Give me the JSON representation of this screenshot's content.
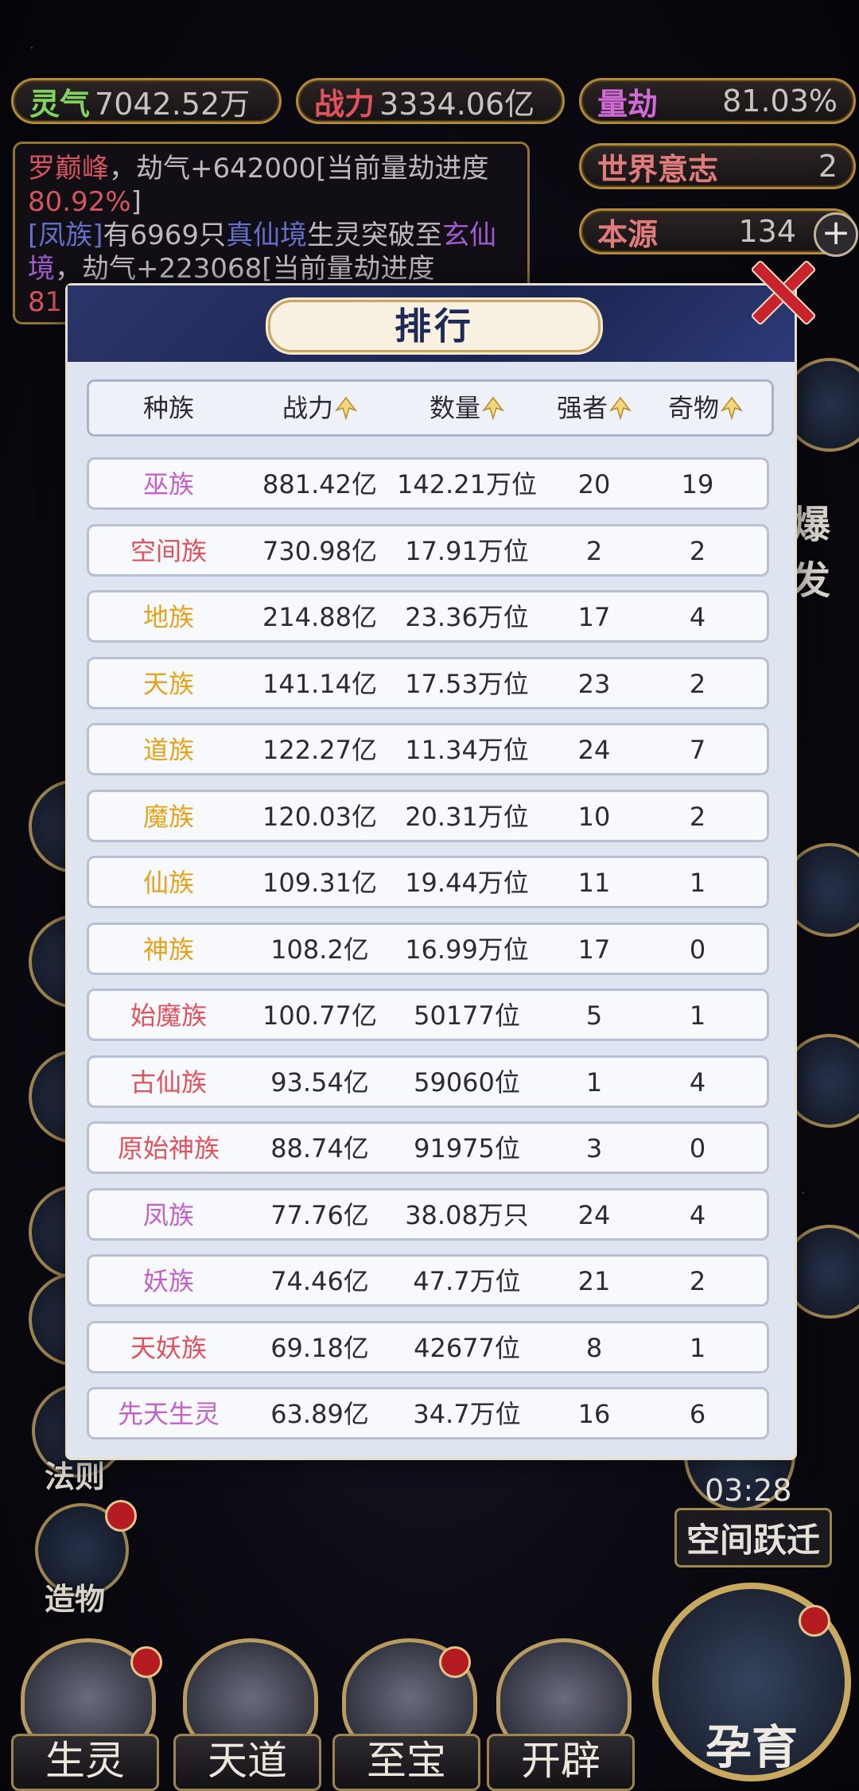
{
  "stats": {
    "lingqi": {
      "label": "灵气",
      "value": "7042.52万"
    },
    "zhanli": {
      "label": "战力",
      "value": "3334.06亿"
    },
    "liangjie": {
      "label": "量劫",
      "value": "81.03%"
    },
    "world_will": {
      "label": "世界意志",
      "value": "2"
    },
    "source": {
      "label": "本源",
      "value": "134"
    }
  },
  "log": {
    "line1_name": "罗巅峰",
    "line1_text": "，劫气+642000[当前量劫进度",
    "line1_pct": "80.92%",
    "line1_end": "]",
    "line2_tag": "[凤族]",
    "line2_text": "有6969只",
    "line2_realm": "真仙境",
    "line2_mid": "生灵突破至",
    "line2_realm2": "玄仙",
    "line3_realm_end": "境",
    "line3_text": "，劫气+223068[当前量劫进度",
    "line4_pct": "81"
  },
  "modal": {
    "title": "排行",
    "columns": {
      "race": "种族",
      "power": "战力",
      "count": "数量",
      "strong": "强者",
      "relic": "奇物"
    },
    "rows": [
      {
        "name": "巫族",
        "power": "881.42亿",
        "count": "142.21万位",
        "strong": "20",
        "relic": "19",
        "color": "#c262c9"
      },
      {
        "name": "空间族",
        "power": "730.98亿",
        "count": "17.91万位",
        "strong": "2",
        "relic": "2",
        "color": "#e0525c"
      },
      {
        "name": "地族",
        "power": "214.88亿",
        "count": "23.36万位",
        "strong": "17",
        "relic": "4",
        "color": "#e6a21a"
      },
      {
        "name": "天族",
        "power": "141.14亿",
        "count": "17.53万位",
        "strong": "23",
        "relic": "2",
        "color": "#e6a21a"
      },
      {
        "name": "道族",
        "power": "122.27亿",
        "count": "11.34万位",
        "strong": "24",
        "relic": "7",
        "color": "#e6a21a"
      },
      {
        "name": "魔族",
        "power": "120.03亿",
        "count": "20.31万位",
        "strong": "10",
        "relic": "2",
        "color": "#e6a21a"
      },
      {
        "name": "仙族",
        "power": "109.31亿",
        "count": "19.44万位",
        "strong": "11",
        "relic": "1",
        "color": "#e6a21a"
      },
      {
        "name": "神族",
        "power": "108.2亿",
        "count": "16.99万位",
        "strong": "17",
        "relic": "0",
        "color": "#e6a21a"
      },
      {
        "name": "始魔族",
        "power": "100.77亿",
        "count": "50177位",
        "strong": "5",
        "relic": "1",
        "color": "#e0525c"
      },
      {
        "name": "古仙族",
        "power": "93.54亿",
        "count": "59060位",
        "strong": "1",
        "relic": "4",
        "color": "#e0525c"
      },
      {
        "name": "原始神族",
        "power": "88.74亿",
        "count": "91975位",
        "strong": "3",
        "relic": "0",
        "color": "#e0525c"
      },
      {
        "name": "凤族",
        "power": "77.76亿",
        "count": "38.08万只",
        "strong": "24",
        "relic": "4",
        "color": "#c262c9"
      },
      {
        "name": "妖族",
        "power": "74.46亿",
        "count": "47.7万位",
        "strong": "21",
        "relic": "2",
        "color": "#c262c9"
      },
      {
        "name": "天妖族",
        "power": "69.18亿",
        "count": "42677位",
        "strong": "8",
        "relic": "1",
        "color": "#e0525c"
      },
      {
        "name": "先天生灵",
        "power": "63.89亿",
        "count": "34.7万位",
        "strong": "16",
        "relic": "6",
        "color": "#c262c9"
      }
    ]
  },
  "side": {
    "left_fa_ze": "法则",
    "left_zao_wu": "造物",
    "right_fragment": "爆发",
    "timer": "03:28",
    "space_jump": "空间跃迁"
  },
  "nav": {
    "sheng_ling": "生灵",
    "tian_dao": "天道",
    "zhi_bao": "至宝",
    "kai_pi": "开辟",
    "yun_yu": "孕育"
  }
}
